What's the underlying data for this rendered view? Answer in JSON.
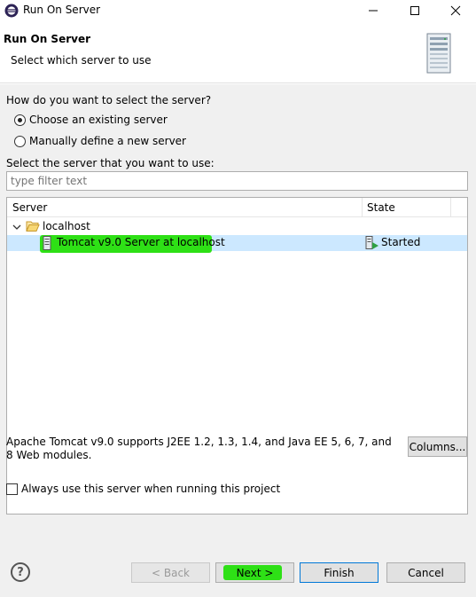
{
  "window": {
    "title": "Run On Server"
  },
  "banner": {
    "title": "Run On Server",
    "subtitle": "Select which server to use"
  },
  "question": "How do you want to select the server?",
  "options": {
    "existing": "Choose an existing server",
    "manual": "Manually define a new server",
    "selected": "existing"
  },
  "select_label": "Select the server that you want to use:",
  "filter": {
    "placeholder": "type filter text",
    "value": ""
  },
  "table": {
    "columns": [
      "Server",
      "State"
    ],
    "group": "localhost",
    "server_name": "Tomcat v9.0 Server at localhost",
    "server_state": "Started"
  },
  "description": "Apache Tomcat v9.0 supports J2EE 1.2, 1.3, 1.4, and Java EE 5, 6, 7, and 8 Web modules.",
  "columns_button": "Columns...",
  "always_use": "Always use this server when running this project",
  "buttons": {
    "help": "?",
    "back": "< Back",
    "next": "Next >",
    "finish": "Finish",
    "cancel": "Cancel"
  },
  "colors": {
    "highlight": "#2ee016",
    "selection": "#cce8ff",
    "dialog_bg": "#f0f0f0"
  }
}
